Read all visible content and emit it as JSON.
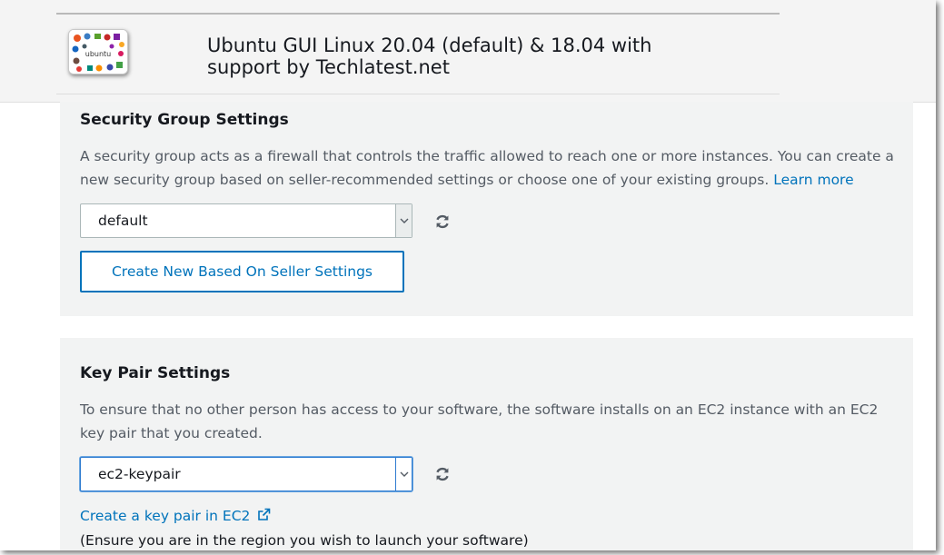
{
  "header": {
    "logo_text": "ubuntu",
    "product_title": "Ubuntu GUI Linux 20.04 (default) & 18.04 with\nsupport by Techlatest.net"
  },
  "security_group": {
    "title": "Security Group Settings",
    "description": "A security group acts as a firewall that controls the traffic allowed to reach one or more instances. You can create a new security group based on seller-recommended settings or choose one of your existing groups.",
    "learn_more": "Learn more",
    "selected": "default",
    "refresh_icon": "refresh-icon",
    "create_button": "Create New Based On Seller Settings"
  },
  "key_pair": {
    "title": "Key Pair Settings",
    "description": "To ensure that no other person has access to your software, the software installs on an EC2 instance with an EC2 key pair that you created.",
    "selected": "ec2-keypair",
    "refresh_icon": "refresh-icon",
    "create_link": "Create a key pair in EC2",
    "external_icon": "external-link-icon",
    "region_note": "(Ensure you are in the region you wish to launch your software)"
  },
  "colors": {
    "link": "#0073bb",
    "panel_bg": "#f2f3f3",
    "text": "#16191f",
    "muted_text": "#545b64",
    "focus_border": "#2e7bd0"
  }
}
